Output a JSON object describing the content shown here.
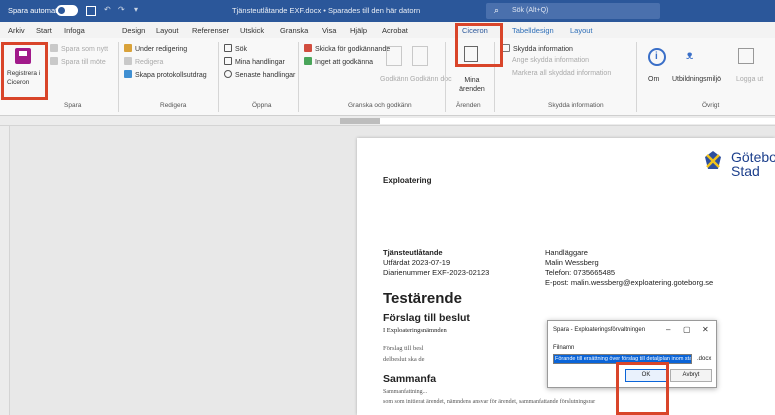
{
  "titlebar": {
    "autosave_label": "Spara automatiskt",
    "doc_title": "Tjänsteutlåtande EXF.docx • Sparades till den här datorn",
    "search_placeholder": "Sök (Alt+Q)"
  },
  "tabs": [
    "Arkiv",
    "Start",
    "Infoga",
    "Design",
    "Layout",
    "Referenser",
    "Utskick",
    "Granska",
    "Visa",
    "Hjälp",
    "Acrobat",
    "Ciceron",
    "Tabelldesign",
    "Layout"
  ],
  "active_tab": "Ciceron",
  "ribbon": {
    "spara_group": {
      "register_button": "Registrera i Ciceron",
      "save_new": "Spara som nytt",
      "save_to_meeting": "Spara till möte",
      "label": "Spara"
    },
    "redigera_group": {
      "under_editing": "Under redigering",
      "edit": "Redigera",
      "create_protocol_excerpt": "Skapa protokollsutdrag",
      "label": "Redigera"
    },
    "oppna_group": {
      "search": "Sök",
      "my_cases": "Mina handlingar",
      "recent_cases": "Senaste handlingar",
      "label": "Öppna"
    },
    "granska_group": {
      "send_for_approval": "Skicka för godkännande",
      "no_approval": "Inget att godkänna",
      "approve": "Godkänn",
      "approved_documents": "Godkänn doc",
      "label": "Granska och godkänn"
    },
    "arenden_group": {
      "my_cases": "Mina ärenden",
      "label": "Ärenden"
    },
    "skyddad_group": {
      "protected_info": "Skydda information",
      "mark_protected": "Ange skydda information",
      "mark_all_protected": "Markera all skyddad information",
      "label": "Skydda information"
    },
    "ovrigt_group": {
      "about": "Om",
      "training": "Utbildningsmiljö",
      "log_in": "Logga ut",
      "label": "Övrigt"
    }
  },
  "document": {
    "department": "Exploatering",
    "logo_line1": "Göteborg",
    "logo_line2": "Stad",
    "doc_type": "Tjänsteutlåtande",
    "issued": "Utfärdat 2023-07-19",
    "diarienummer": "Diarienummer EXF-2023-02123",
    "handler_label": "Handläggare",
    "handler_name": "Malin Wessberg",
    "phone": "Telefon: 0735665485",
    "email": "E-post: malin.wessberg@exploatering.goteborg.se",
    "heading": "Testärende",
    "section1": "Förslag till beslut",
    "section1_line": "I Exploateringsnämnden",
    "body_line1": "Förslag till besl",
    "body_line2": "delbeslut ska de",
    "section2": "Sammanfa",
    "body_line3": "Sammanfattning...",
    "body_line4": "som som initierat ärendet, nämndens ansvar för ärendet, sammanfattande förslutningsrar"
  },
  "dialog": {
    "title": "Spara - Exploateringsförvaltningen",
    "filename_label": "Filnamn",
    "filename_value": "Förande till ersättning över förslag till detaljplan inom stadsdelen av",
    "extension": ".docx",
    "ok": "OK",
    "cancel": "Avbryt"
  },
  "colors": {
    "titlebar": "#2b579a",
    "highlight_box": "#d9452a",
    "selection": "#0a64d8"
  }
}
